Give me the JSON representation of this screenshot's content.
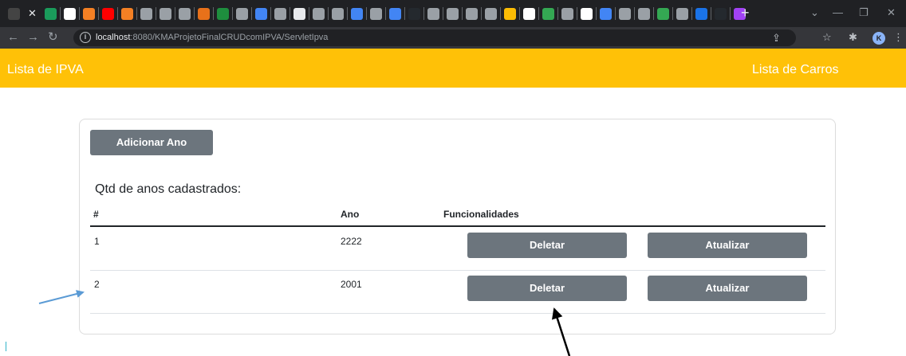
{
  "browser": {
    "tab_icons": [
      {
        "name": "app-icon",
        "color": "#444444"
      },
      {
        "name": "webflow-icon",
        "color": "#1a9b5b"
      },
      {
        "name": "google-icon",
        "color": "#ffffff"
      },
      {
        "name": "stackoverflow-icon",
        "color": "#f48024"
      },
      {
        "name": "youtube-icon",
        "color": "#ff0000"
      },
      {
        "name": "stackoverflow-icon",
        "color": "#f48024"
      },
      {
        "name": "globe-icon",
        "color": "#9aa0a6"
      },
      {
        "name": "globe-icon",
        "color": "#9aa0a6"
      },
      {
        "name": "globe-icon",
        "color": "#9aa0a6"
      },
      {
        "name": "app-icon",
        "color": "#e8711a"
      },
      {
        "name": "classroom-icon",
        "color": "#1e8e3e"
      },
      {
        "name": "globe-icon",
        "color": "#9aa0a6"
      },
      {
        "name": "meet-icon",
        "color": "#4285f4"
      },
      {
        "name": "globe-icon",
        "color": "#9aa0a6"
      },
      {
        "name": "amazon-icon",
        "color": "#e8eaed"
      },
      {
        "name": "globe-icon",
        "color": "#9aa0a6"
      },
      {
        "name": "globe-icon",
        "color": "#9aa0a6"
      },
      {
        "name": "meet-icon",
        "color": "#4285f4"
      },
      {
        "name": "globe-icon",
        "color": "#9aa0a6"
      },
      {
        "name": "meet-icon",
        "color": "#4285f4"
      },
      {
        "name": "github-icon",
        "color": "#24292e"
      },
      {
        "name": "globe-icon",
        "color": "#9aa0a6"
      },
      {
        "name": "globe-icon",
        "color": "#9aa0a6"
      },
      {
        "name": "globe-icon",
        "color": "#9aa0a6"
      },
      {
        "name": "globe-icon",
        "color": "#9aa0a6"
      },
      {
        "name": "emoji-icon",
        "color": "#fbbc04"
      },
      {
        "name": "google-icon",
        "color": "#ffffff"
      },
      {
        "name": "app-icon",
        "color": "#34a853"
      },
      {
        "name": "globe-icon",
        "color": "#9aa0a6"
      },
      {
        "name": "google-icon",
        "color": "#ffffff"
      },
      {
        "name": "app-icon",
        "color": "#4285f4"
      },
      {
        "name": "globe-icon",
        "color": "#9aa0a6"
      },
      {
        "name": "globe-icon",
        "color": "#9aa0a6"
      },
      {
        "name": "app-icon",
        "color": "#34a853"
      },
      {
        "name": "globe-icon",
        "color": "#9aa0a6"
      },
      {
        "name": "app-icon",
        "color": "#1a73e8"
      },
      {
        "name": "github-icon",
        "color": "#24292e"
      },
      {
        "name": "app-icon",
        "color": "#a142f4"
      }
    ],
    "new_tab_label": "+",
    "url_host": "localhost",
    "url_rest": ":8080/KMAProjetoFinalCRUDcomIPVA/ServletIpva",
    "profile_initial": "K"
  },
  "app": {
    "brand": "Lista de IPVA",
    "nav_link": "Lista de Carros",
    "colors": {
      "navbar": "#ffc107",
      "button": "#6c757d"
    }
  },
  "card": {
    "add_button": "Adicionar Ano",
    "count_title": "Qtd de anos cadastrados:",
    "count_value": "",
    "headers": {
      "index": "#",
      "year": "Ano",
      "actions": "Funcionalidades"
    },
    "rows": [
      {
        "index": "1",
        "year": "2222",
        "delete_label": "Deletar",
        "update_label": "Atualizar"
      },
      {
        "index": "2",
        "year": "2001",
        "delete_label": "Deletar",
        "update_label": "Atualizar"
      }
    ]
  },
  "annotations": {
    "blue_arrow_color": "#5b9bd5",
    "black_arrow_color": "#000000"
  }
}
